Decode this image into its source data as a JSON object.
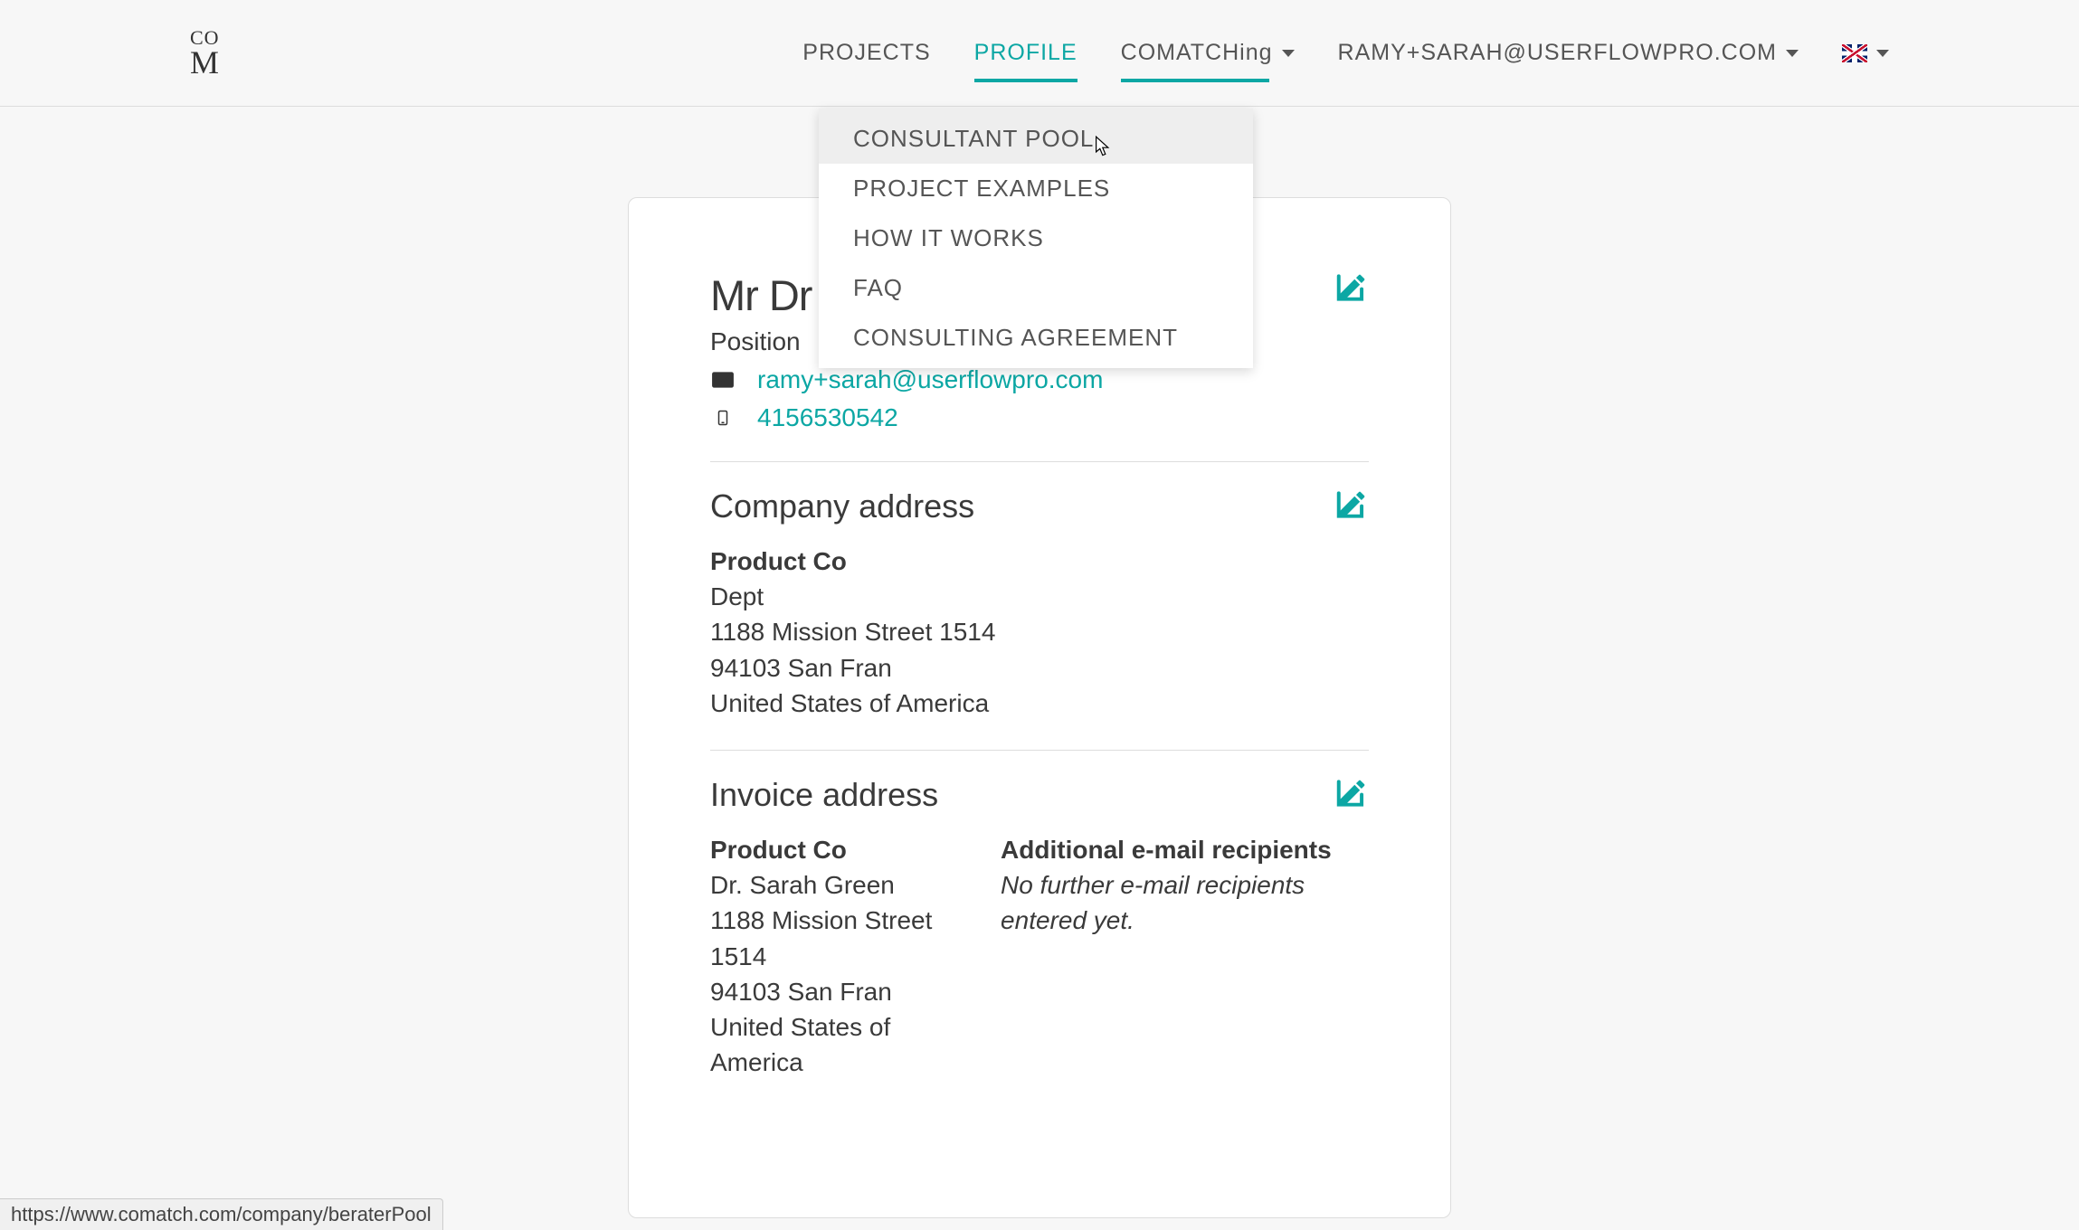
{
  "logo": {
    "top": "CO",
    "bottom": "M"
  },
  "nav": {
    "projects": "PROJECTS",
    "profile": "PROFILE",
    "comatching": "COMATCHing",
    "user_email": "RAMY+SARAH@USERFLOWPRO.COM"
  },
  "dropdown": {
    "items": [
      "CONSULTANT POOL",
      "PROJECT EXAMPLES",
      "HOW IT WORKS",
      "FAQ",
      "CONSULTING AGREEMENT"
    ]
  },
  "profile": {
    "name_visible": "Mr Dr",
    "position_label": "Position",
    "email": "ramy+sarah@userflowpro.com",
    "phone": "4156530542"
  },
  "company_address": {
    "title": "Company address",
    "company": "Product Co",
    "dept": "Dept",
    "street": "1188 Mission Street 1514",
    "city_zip": "94103 San Fran",
    "country": "United States of America"
  },
  "invoice_address": {
    "title": "Invoice address",
    "company": "Product Co",
    "contact": "Dr. Sarah Green",
    "street": "1188 Mission Street 1514",
    "city_zip": "94103 San Fran",
    "country": "United States of America",
    "recipients_label": "Additional e-mail recipients",
    "recipients_empty": "No further e-mail recipients entered yet."
  },
  "status_url": "https://www.comatch.com/company/beraterPool"
}
